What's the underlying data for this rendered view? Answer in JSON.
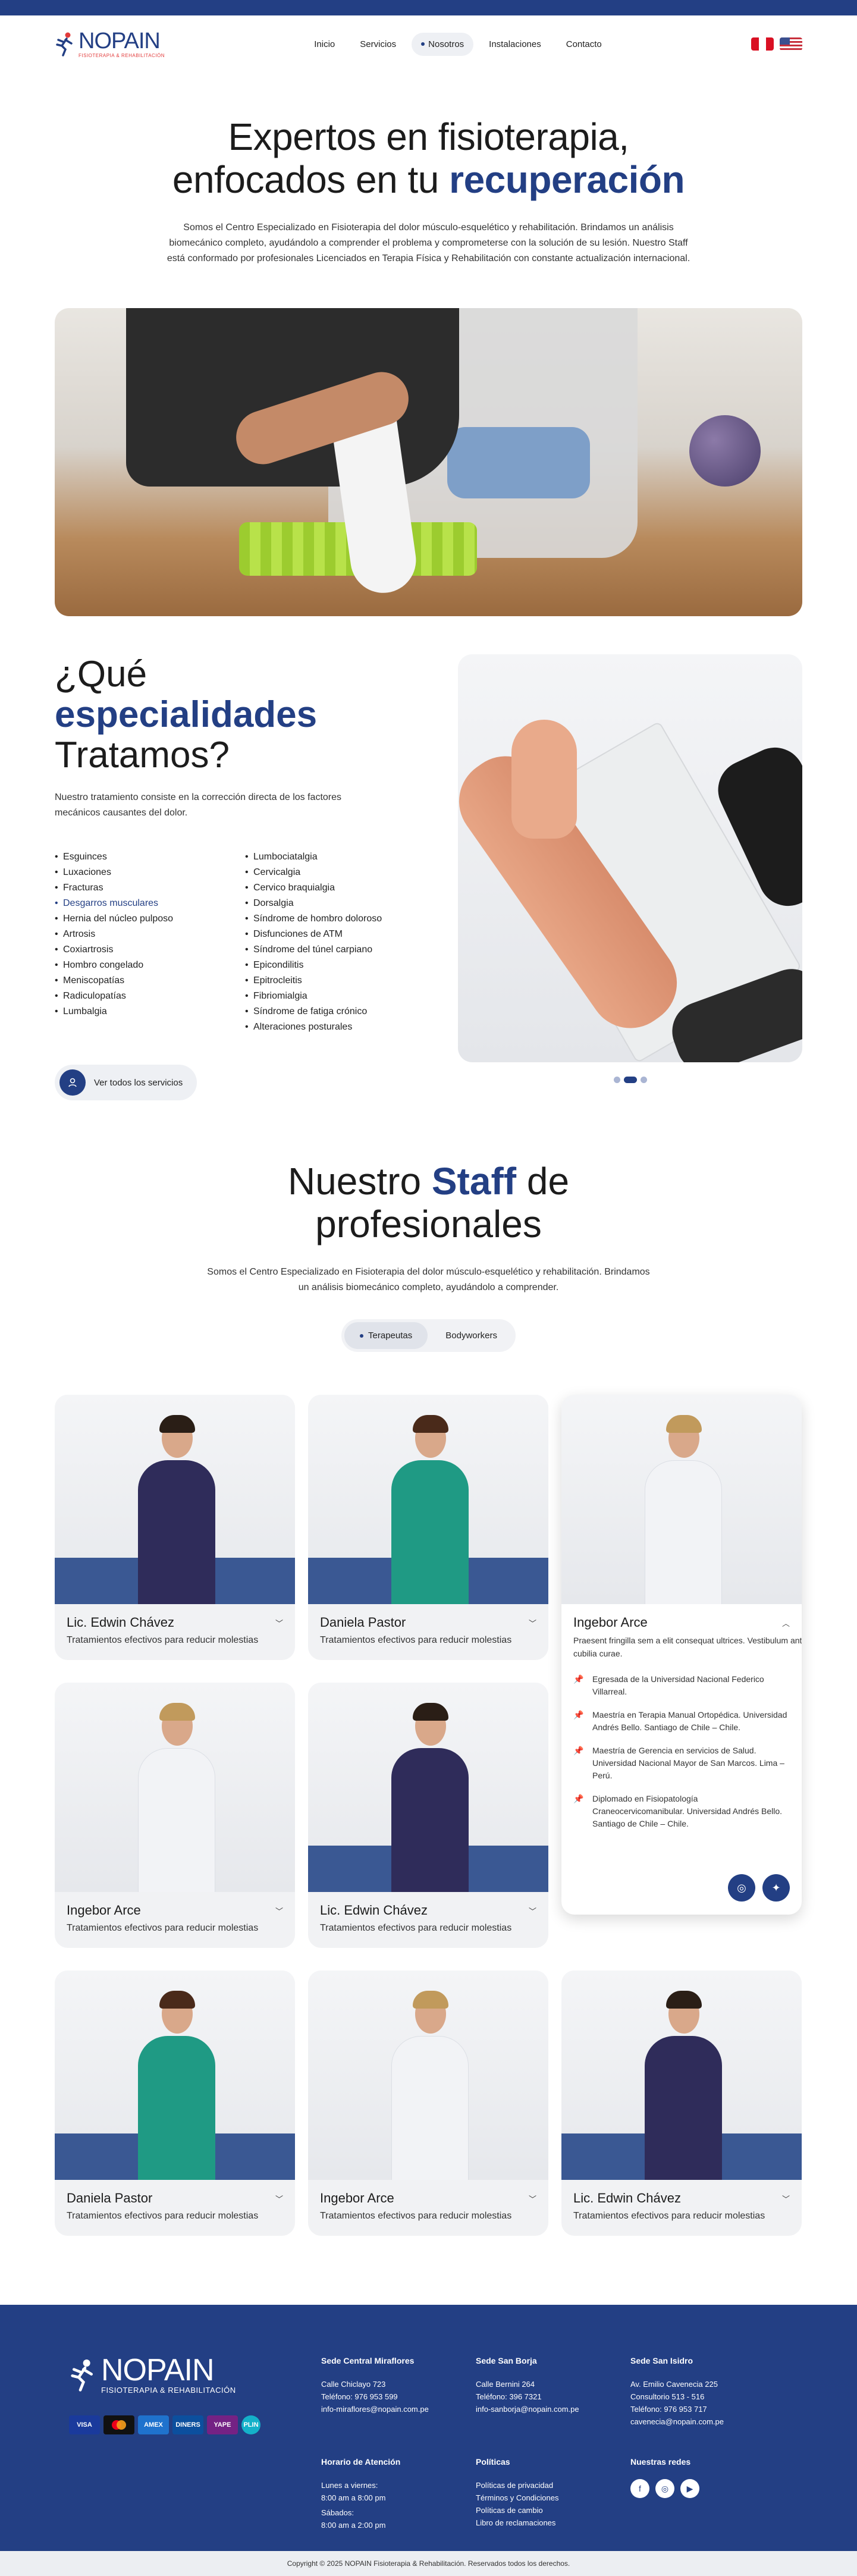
{
  "colors": {
    "brand": "#233f84",
    "brand_light": "#eef0f4",
    "footer_bg": "#233f84"
  },
  "logo": {
    "word": "NOPAIN",
    "sub": "FISIOTERAPIA & REHABILITACIÓN"
  },
  "nav": [
    "Inicio",
    "Servicios",
    "Nosotros",
    "Instalaciones",
    "Contacto"
  ],
  "nav_active": "Nosotros",
  "hero": {
    "line1": "Expertos en fisioterapia,",
    "line2_pre": "enfocados en tu ",
    "line2_accent": "recuperación",
    "text": "Somos el Centro Especializado en Fisioterapia del dolor músculo-esquelético y rehabilitación. Brindamos un análisis biomecánico completo, ayudándolo a comprender el problema y comprometerse con la solución de su lesión. Nuestro Staff está conformado por profesionales Licenciados en Terapia Física y Rehabilitación con constante actualización internacional."
  },
  "specialties": {
    "title_1": "¿Qué",
    "title_accent": "especialidades",
    "title_3": "Tratamos?",
    "intro": "Nuestro tratamiento consiste en la corrección directa de los factores mecánicos causantes del dolor.",
    "col1": [
      "Esguinces",
      "Luxaciones",
      "Fracturas",
      "Desgarros musculares",
      "Hernia del núcleo pulposo",
      "Artrosis",
      "Coxiartrosis",
      "Hombro congelado",
      "Meniscopatías",
      "Radiculopatías",
      "Lumbalgia"
    ],
    "col2": [
      "Lumbociatalgia",
      "Cervicalgia",
      "Cervico braquialgia",
      "Dorsalgia",
      "Síndrome de hombro doloroso",
      "Disfunciones de ATM",
      "Síndrome del túnel carpiano",
      "Epicondilitis",
      "Epitrocleitis",
      "Fibriomialgia",
      "Síndrome de fatiga crónico",
      "Alteraciones posturales"
    ],
    "button": "Ver todos los servicios"
  },
  "staff": {
    "title_pre": "Nuestro ",
    "title_accent": "Staff",
    "title_post": " de",
    "title_line2": "profesionales",
    "text": "Somos el Centro Especializado en Fisioterapia del dolor músculo-esquelético y rehabilitación. Brindamos un análisis biomecánico completo, ayudándolo a comprender.",
    "tabs": [
      "Terapeutas",
      "Bodyworkers"
    ],
    "cards": [
      {
        "name": "Lic. Edwin Chávez",
        "desc": "Tratamientos efectivos para reducir molestias"
      },
      {
        "name": "Daniela Pastor",
        "desc": "Tratamientos efectivos para reducir molestias"
      },
      {
        "name": "Ingebor Arce",
        "desc": "Tratamientos efectivos para reducir molestias"
      },
      {
        "name": "Ingebor Arce",
        "desc": "Tratamientos efectivos para reducir molestias"
      },
      {
        "name": "Lic. Edwin Chávez",
        "desc": "Tratamientos efectivos para reducir molestias"
      },
      {
        "name": "Daniela Pastor",
        "desc": "Tratamientos efectivos para reducir molestias"
      },
      {
        "name": "Ingebor Arce",
        "desc": "Tratamientos efectivos para reducir molestias"
      },
      {
        "name": "Lic. Edwin Chávez",
        "desc": "Tratamientos efectivos para reducir molestias"
      }
    ],
    "expanded": {
      "name": "Ingebor Arce",
      "lead": "Praesent fringilla sem a elit consequat ultrices. Vestibulum ante ipsum primis in faucibus orci luctus et ultrices posuere cubilia curae.",
      "items": [
        "Egresada de la Universidad Nacional Federico Villarreal.",
        "Maestría en Terapia Manual Ortopédica. Universidad Andrés Bello. Santiago de Chile – Chile.",
        "Maestría de Gerencia en servicios de Salud. Universidad Nacional Mayor de San Marcos. Lima – Perú.",
        "Diplomado en Fisiopatología Craneocervicomanibular. Universidad Andrés Bello. Santiago de Chile – Chile."
      ]
    }
  },
  "footer": {
    "payments": [
      "VISA",
      "MC",
      "AMEX",
      "DINERS",
      "YAPE",
      "PLIN"
    ],
    "sedes": [
      {
        "title": "Sede Central Miraflores",
        "lines": [
          "Calle Chiclayo 723",
          "Teléfono: 976 953 599",
          "info-miraflores@nopain.com.pe"
        ]
      },
      {
        "title": "Sede San Borja",
        "lines": [
          "Calle Bernini 264",
          "Teléfono: 396 7321",
          "info-sanborja@nopain.com.pe"
        ]
      },
      {
        "title": "Sede San Isidro",
        "lines": [
          "Av. Emilio Cavenecia 225",
          "Consultorio 513 - 516",
          "Teléfono: 976 953 717",
          "cavenecia@nopain.com.pe"
        ]
      }
    ],
    "horario": {
      "title": "Horario de Atención",
      "lines": [
        "Lunes a viernes:",
        "8:00 am a 8:00 pm",
        "Sábados:",
        "8:00 am a 2:00 pm"
      ]
    },
    "politicas": {
      "title": "Políticas",
      "lines": [
        "Políticas de privacidad",
        "Términos y Condiciones",
        "Políticas de cambio",
        "Libro de reclamaciones"
      ]
    },
    "redes": {
      "title": "Nuestras redes",
      "icons": [
        "facebook-icon",
        "instagram-icon",
        "youtube-icon"
      ]
    },
    "copyright": "Copyright © 2025 NOPAIN Fisioterapia & Rehabilitación. Reservados todos los derechos."
  }
}
